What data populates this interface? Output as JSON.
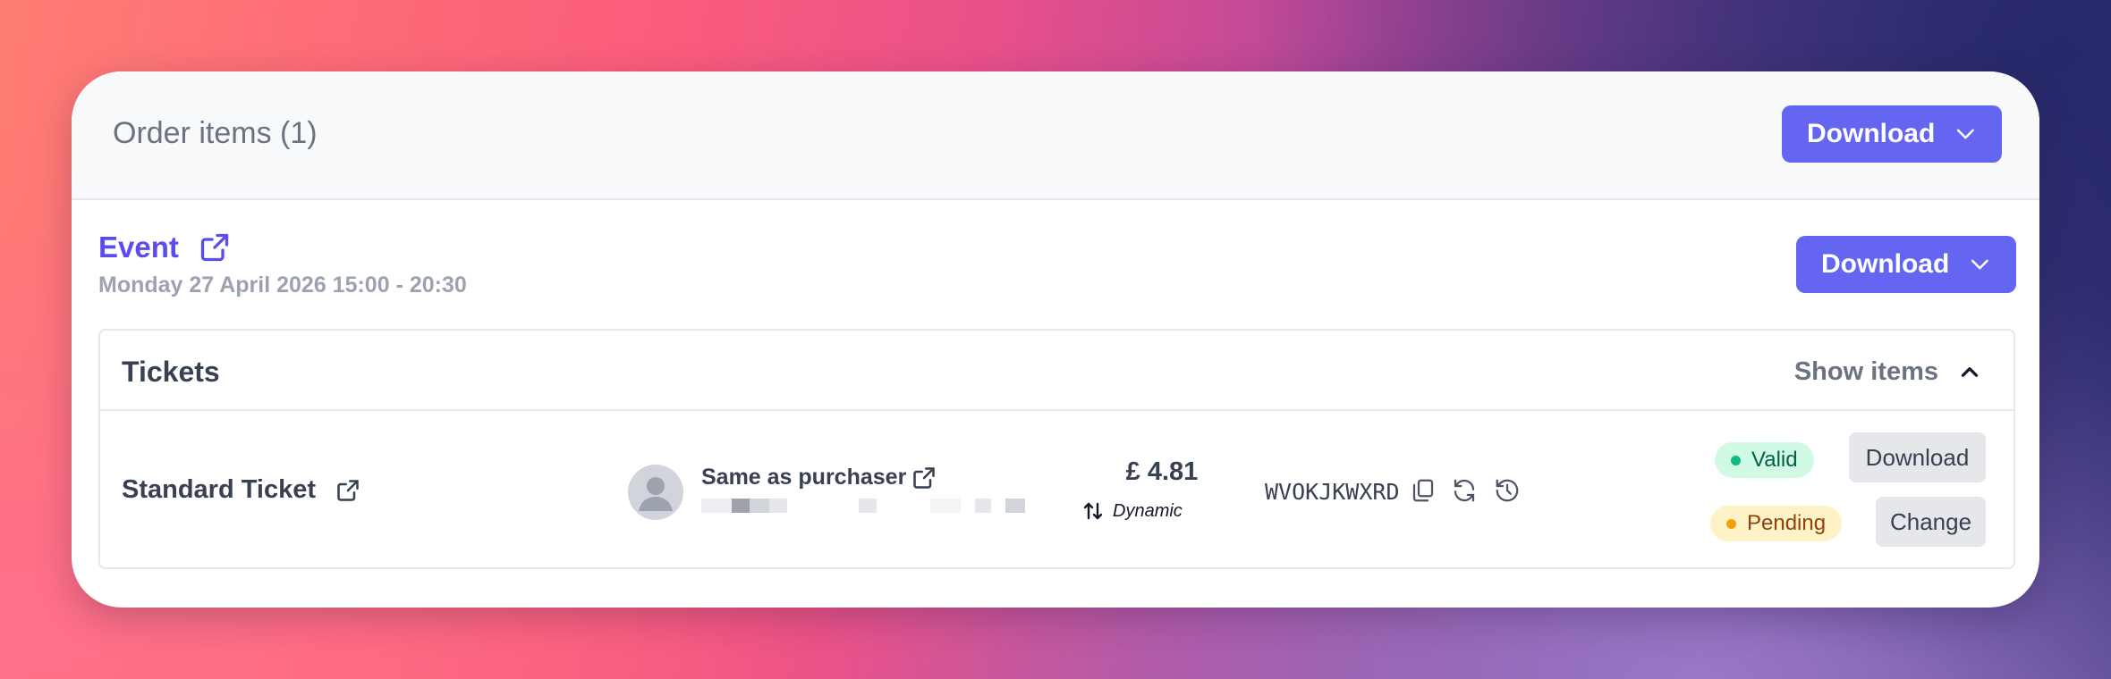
{
  "card": {
    "title": "Order items (1)",
    "download_label": "Download"
  },
  "event": {
    "title": "Event",
    "date": "Monday 27 April 2026 15:00 - 20:30",
    "download_label": "Download"
  },
  "tickets": {
    "label": "Tickets",
    "toggle_label": "Show items",
    "rows": [
      {
        "name": "Standard Ticket",
        "holder": "Same as purchaser",
        "price": "£ 4.81",
        "price_type": "Dynamic",
        "code": "WVOKJKWXRD",
        "statuses": [
          "Valid",
          "Pending"
        ],
        "actions": [
          "Download",
          "Change"
        ]
      }
    ]
  },
  "colors": {
    "primary": "#6466f1",
    "event_link": "#5b4cf0",
    "valid": "#10b981",
    "pending": "#f59e0b"
  },
  "icons": [
    "chevron-down-icon",
    "external-link-icon",
    "chevron-up-icon",
    "user-avatar-icon",
    "sort-arrows-icon",
    "copy-icon",
    "refresh-icon",
    "history-icon"
  ]
}
